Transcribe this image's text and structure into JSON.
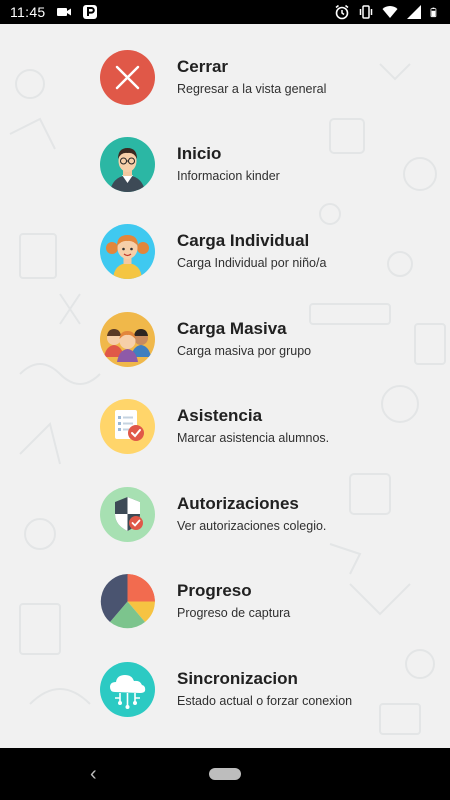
{
  "status_bar": {
    "time": "11:45",
    "icons": [
      "video-camera-icon",
      "parking-p-icon",
      "alarm-icon",
      "vibrate-icon",
      "wifi-icon",
      "signal-icon",
      "battery-icon"
    ]
  },
  "menu": {
    "items": [
      {
        "icon": "close-x-icon",
        "color": "#e05848",
        "title": "Cerrar",
        "subtitle": "Regresar a la vista general"
      },
      {
        "icon": "teacher-avatar-icon",
        "color": "#2bb7a4",
        "title": "Inicio",
        "subtitle": "Informacion kinder"
      },
      {
        "icon": "girl-avatar-icon",
        "color": "#3fc9f0",
        "title": "Carga Individual",
        "subtitle": "Carga Individual por niño/a"
      },
      {
        "icon": "group-kids-icon",
        "color": "#f0b84a",
        "title": "Carga Masiva",
        "subtitle": "Carga masiva por grupo"
      },
      {
        "icon": "checklist-icon",
        "color": "#ffd56a",
        "title": "Asistencia",
        "subtitle": "Marcar asistencia alumnos."
      },
      {
        "icon": "shield-check-icon",
        "color": "#a7e0b2",
        "title": "Autorizaciones",
        "subtitle": "Ver autorizaciones colegio."
      },
      {
        "icon": "pie-chart-icon",
        "color": "#f1f1f1",
        "title": "Progreso",
        "subtitle": "Progreso de captura"
      },
      {
        "icon": "cloud-sync-icon",
        "color": "#2ccac3",
        "title": "Sincronizacion",
        "subtitle": "Estado actual o forzar conexion"
      }
    ]
  },
  "nav_bar": {
    "back_glyph": "‹"
  }
}
